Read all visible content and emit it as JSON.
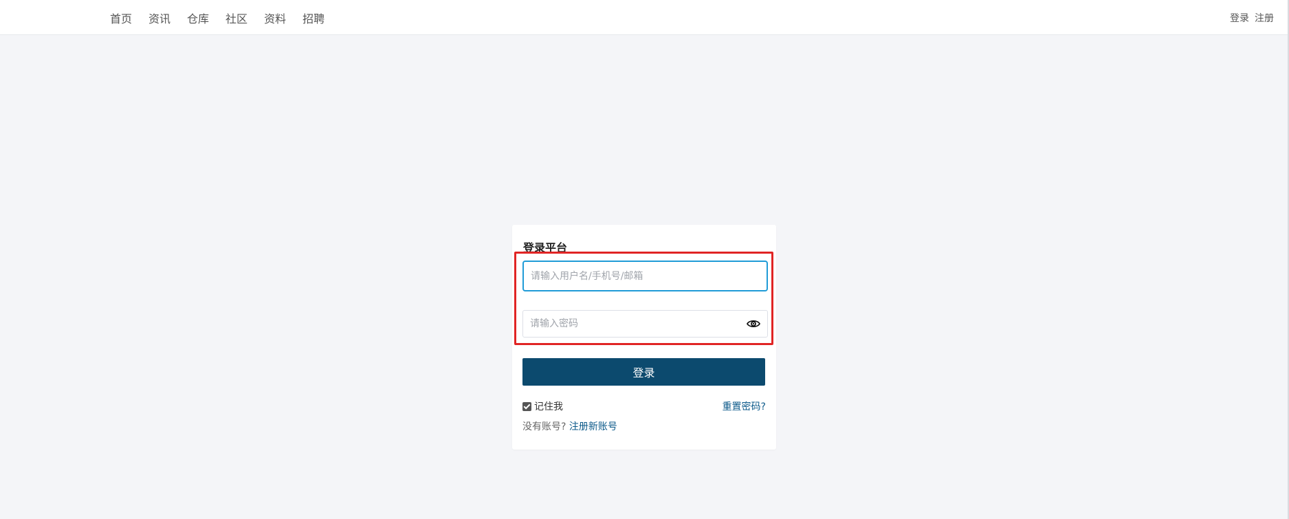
{
  "nav": {
    "items": [
      {
        "label": "首页"
      },
      {
        "label": "资讯"
      },
      {
        "label": "仓库"
      },
      {
        "label": "社区"
      },
      {
        "label": "资料"
      },
      {
        "label": "招聘"
      }
    ],
    "login_label": "登录",
    "register_label": "注册"
  },
  "login": {
    "title": "登录平台",
    "username_placeholder": "请输入用户名/手机号/邮箱",
    "username_value": "",
    "password_placeholder": "请输入密码",
    "password_value": "",
    "submit_label": "登录",
    "remember_label": "记住我",
    "remember_checked": true,
    "reset_label": "重置密码?",
    "no_account_text": "没有账号?",
    "register_link_label": "注册新账号"
  },
  "colors": {
    "primary": "#0c4a6e",
    "link": "#0c5a8a",
    "focus_border": "#1f9bd7",
    "highlight": "#e02424",
    "background": "#f4f5f8"
  },
  "icons": {
    "password_toggle": "eye-icon"
  }
}
